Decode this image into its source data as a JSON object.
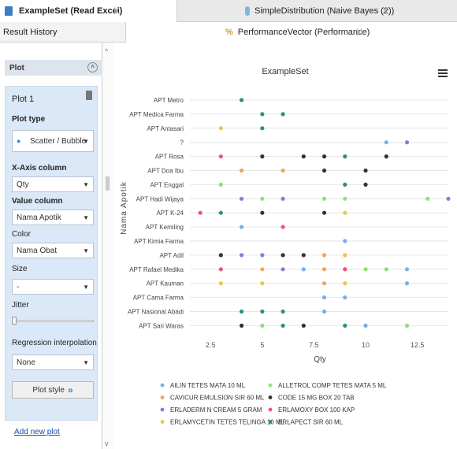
{
  "tabs": [
    {
      "label": "ExampleSet (Read Excel)",
      "close": "X"
    },
    {
      "label": "SimpleDistribution (Naive Bayes (2))",
      "close": "X"
    }
  ],
  "subtabs": [
    {
      "label": "Result History"
    },
    {
      "label": "PerformanceVector (Performance)",
      "icon": "%",
      "close": "X"
    }
  ],
  "panel": {
    "header": "Plot",
    "collapse_icon": "^",
    "plot_name": "Plot 1",
    "plot_type_label": "Plot type",
    "plot_type_value": "Scatter / Bubble",
    "x_axis_label": "X-Axis column",
    "x_axis_value": "Qty",
    "value_label": "Value column",
    "value_value": "Nama Apotik",
    "color_label": "Color",
    "color_value": "Nama Obat",
    "size_label": "Size",
    "size_value": "-",
    "jitter_label": "Jitter",
    "regression_label": "Regression interpolation",
    "regression_value": "None",
    "plot_style_label": "Plot style",
    "add_new_label": "Add new plot"
  },
  "colors": {
    "AILIN TETES MATA 10 ML": "#7aaee8",
    "CAVICUR EMULSION SIR 60 ML": "#f5a455",
    "ERLADERM N CREAM 5 GRAM": "#7f7fe0",
    "ERLAMYCETIN TETES TELINGA 10 ML": "#e8c84a",
    "ALLETROL COMP TETES MATA 5 ML": "#8fe07a",
    "CODE 15 MG BOX 20 TAB": "#333333",
    "ERLAMOXY BOX 100 KAP": "#f0537a",
    "ERLAPECT SIR 60 ML": "#2a8f88"
  },
  "chart_data": {
    "type": "scatter",
    "title": "ExampleSet",
    "xlabel": "Qty",
    "ylabel": "Nama Apotik",
    "xlim": [
      1.5,
      14
    ],
    "xticks": [
      "2.5",
      "5",
      "7.5",
      "10",
      "12.5"
    ],
    "categories": [
      "APT Metro",
      "APT Medica Farma",
      "APT Antasari",
      "?",
      "APT Rosa",
      "APT Doa Ibu",
      "APT Enggal",
      "APT Hadi Wijaya",
      "APT K-24",
      "APT Kemiling",
      "APT Kimia Farma",
      "APT Adil",
      "APT Rafael Medika",
      "APT Kauman",
      "APT Cama Farma",
      "APT Nasional Abadi",
      "APT Sari Waras"
    ],
    "legend_rows": [
      [
        "AILIN TETES MATA 10 ML",
        "ALLETROL COMP TETES MATA 5 ML"
      ],
      [
        "CAVICUR EMULSION SIR 60 ML",
        "CODE 15 MG BOX 20 TAB"
      ],
      [
        "ERLADERM N CREAM 5 GRAM",
        "ERLAMOXY BOX 100 KAP"
      ],
      [
        "ERLAMYCETIN TETES TELINGA 10 ML",
        "ERLAPECT SIR 60 ML"
      ]
    ],
    "series": [
      {
        "name": "AILIN TETES MATA 10 ML",
        "points": [
          [
            "APT Kemiling",
            4
          ],
          [
            "APT Kimia Farma",
            9
          ],
          [
            "APT Rafael Medika",
            7
          ],
          [
            "APT Rafael Medika",
            12
          ],
          [
            "APT Kauman",
            12
          ],
          [
            "APT Cama Farma",
            8
          ],
          [
            "APT Cama Farma",
            9
          ],
          [
            "APT Nasional Abadi",
            8
          ],
          [
            "APT Sari Waras",
            10
          ],
          [
            "?",
            11
          ]
        ]
      },
      {
        "name": "CAVICUR EMULSION SIR 60 ML",
        "points": [
          [
            "APT Doa Ibu",
            4
          ],
          [
            "APT Doa Ibu",
            6
          ],
          [
            "APT Adil",
            8
          ],
          [
            "APT Rafael Medika",
            5
          ],
          [
            "APT Rafael Medika",
            8
          ],
          [
            "APT Kauman",
            8
          ]
        ]
      },
      {
        "name": "ERLADERM N CREAM 5 GRAM",
        "points": [
          [
            "APT Hadi Wijaya",
            4
          ],
          [
            "APT Hadi Wijaya",
            6
          ],
          [
            "APT Hadi Wijaya",
            14
          ],
          [
            "APT Adil",
            4
          ],
          [
            "APT Adil",
            5
          ],
          [
            "APT Rafael Medika",
            6
          ],
          [
            "?",
            12
          ]
        ]
      },
      {
        "name": "ERLAMYCETIN TETES TELINGA 10 ML",
        "points": [
          [
            "APT Antasari",
            3
          ],
          [
            "APT K-24",
            9
          ],
          [
            "APT Adil",
            9
          ],
          [
            "APT Rafael Medika",
            9
          ],
          [
            "APT Kauman",
            3
          ],
          [
            "APT Kauman",
            5
          ],
          [
            "APT Kauman",
            9
          ]
        ]
      },
      {
        "name": "ALLETROL COMP TETES MATA 5 ML",
        "points": [
          [
            "APT Enggal",
            3
          ],
          [
            "APT Hadi Wijaya",
            5
          ],
          [
            "APT Hadi Wijaya",
            8
          ],
          [
            "APT Hadi Wijaya",
            9
          ],
          [
            "APT Hadi Wijaya",
            13
          ],
          [
            "APT Rafael Medika",
            10
          ],
          [
            "APT Rafael Medika",
            11
          ],
          [
            "APT Sari Waras",
            5
          ],
          [
            "APT Sari Waras",
            12
          ]
        ]
      },
      {
        "name": "CODE 15 MG BOX 20 TAB",
        "points": [
          [
            "APT Rosa",
            5
          ],
          [
            "APT Rosa",
            7
          ],
          [
            "APT Rosa",
            8
          ],
          [
            "APT Rosa",
            11
          ],
          [
            "APT Doa Ibu",
            8
          ],
          [
            "APT Doa Ibu",
            10
          ],
          [
            "APT Enggal",
            10
          ],
          [
            "APT K-24",
            5
          ],
          [
            "APT K-24",
            8
          ],
          [
            "APT Adil",
            3
          ],
          [
            "APT Adil",
            6
          ],
          [
            "APT Adil",
            7
          ],
          [
            "APT Sari Waras",
            4
          ],
          [
            "APT Sari Waras",
            7
          ]
        ]
      },
      {
        "name": "ERLAMOXY BOX 100 KAP",
        "points": [
          [
            "APT Rosa",
            3
          ],
          [
            "APT K-24",
            2
          ],
          [
            "APT Kemiling",
            6
          ],
          [
            "APT Rafael Medika",
            3
          ],
          [
            "APT Rafael Medika",
            9
          ]
        ]
      },
      {
        "name": "ERLAPECT SIR 60 ML",
        "points": [
          [
            "APT Metro",
            4
          ],
          [
            "APT Medica Farma",
            5
          ],
          [
            "APT Medica Farma",
            6
          ],
          [
            "APT Antasari",
            5
          ],
          [
            "APT Rosa",
            9
          ],
          [
            "APT Enggal",
            9
          ],
          [
            "APT K-24",
            3
          ],
          [
            "APT Nasional Abadi",
            4
          ],
          [
            "APT Nasional Abadi",
            5
          ],
          [
            "APT Nasional Abadi",
            6
          ],
          [
            "APT Sari Waras",
            6
          ],
          [
            "APT Sari Waras",
            9
          ]
        ]
      }
    ],
    "grid": true,
    "legend_position": "bottom"
  }
}
